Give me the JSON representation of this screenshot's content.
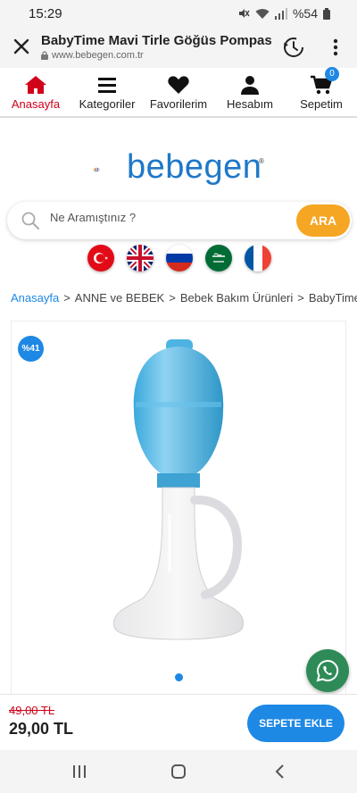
{
  "status": {
    "time": "15:29",
    "battery": "%54"
  },
  "browser": {
    "title": "BabyTime Mavi Tirle Göğüs Pompası -",
    "url": "www.bebegen.com.tr"
  },
  "nav": {
    "items": [
      {
        "label": "Anasayfa",
        "icon": "home-icon"
      },
      {
        "label": "Kategoriler",
        "icon": "menu-icon"
      },
      {
        "label": "Favorilerim",
        "icon": "heart-icon"
      },
      {
        "label": "Hesabım",
        "icon": "user-icon"
      },
      {
        "label": "Sepetim",
        "icon": "cart-icon"
      }
    ],
    "cart_count": "0",
    "active_color": "#d0021b"
  },
  "logo": {
    "text": "bebegen",
    "reg": "®"
  },
  "search": {
    "placeholder": "Ne Aramıştınız ?",
    "button_label": "ARA"
  },
  "languages": [
    "tr",
    "en",
    "ru",
    "ar",
    "fr"
  ],
  "breadcrumb": [
    "Anasayfa",
    "ANNE ve BEBEK",
    "Bebek Bakım Ürünleri",
    "BabyTime"
  ],
  "product": {
    "discount": "%41",
    "old_price": "49,00 TL",
    "new_price": "29,00 TL",
    "add_to_cart": "SEPETE EKLE"
  },
  "colors": {
    "accent": "#1e88e5",
    "search_button": "#f5a623",
    "whatsapp": "#2e8b57",
    "sale": "#d0021b"
  }
}
